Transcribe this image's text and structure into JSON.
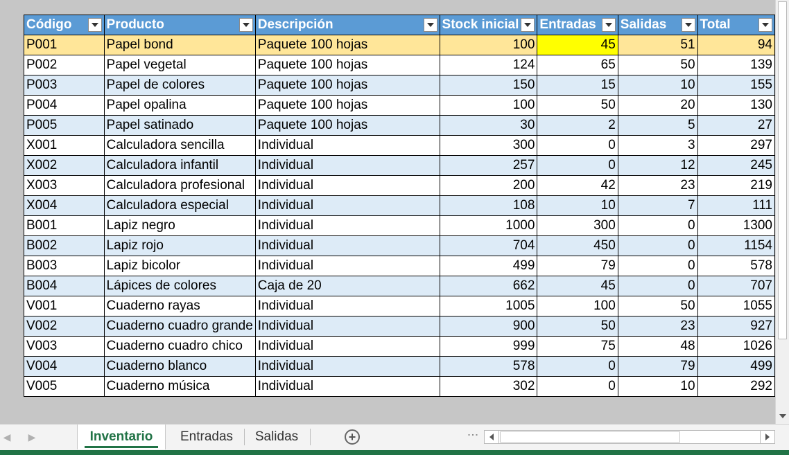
{
  "table": {
    "headers": [
      "Código",
      "Producto",
      "Descripción",
      "Stock inicial",
      "Entradas",
      "Salidas",
      "Total"
    ],
    "rows": [
      [
        "P001",
        "Papel bond",
        "Paquete 100 hojas",
        "100",
        "45",
        "51",
        "94"
      ],
      [
        "P002",
        "Papel vegetal",
        "Paquete 100 hojas",
        "124",
        "65",
        "50",
        "139"
      ],
      [
        "P003",
        "Papel de colores",
        "Paquete 100 hojas",
        "150",
        "15",
        "10",
        "155"
      ],
      [
        "P004",
        "Papel opalina",
        "Paquete 100 hojas",
        "100",
        "50",
        "20",
        "130"
      ],
      [
        "P005",
        "Papel satinado",
        "Paquete 100 hojas",
        "30",
        "2",
        "5",
        "27"
      ],
      [
        "X001",
        "Calculadora sencilla",
        "Individual",
        "300",
        "0",
        "3",
        "297"
      ],
      [
        "X002",
        "Calculadora infantil",
        "Individual",
        "257",
        "0",
        "12",
        "245"
      ],
      [
        "X003",
        "Calculadora profesional",
        "Individual",
        "200",
        "42",
        "23",
        "219"
      ],
      [
        "X004",
        "Calculadora especial",
        "Individual",
        "108",
        "10",
        "7",
        "111"
      ],
      [
        "B001",
        "Lapiz negro",
        "Individual",
        "1000",
        "300",
        "0",
        "1300"
      ],
      [
        "B002",
        "Lapiz rojo",
        "Individual",
        "704",
        "450",
        "0",
        "1154"
      ],
      [
        "B003",
        "Lapiz bicolor",
        "Individual",
        "499",
        "79",
        "0",
        "578"
      ],
      [
        "B004",
        "Lápices de colores",
        "Caja de 20",
        "662",
        "45",
        "0",
        "707"
      ],
      [
        "V001",
        "Cuaderno rayas",
        "Individual",
        "1005",
        "100",
        "50",
        "1055"
      ],
      [
        "V002",
        "Cuaderno cuadro grande",
        "Individual",
        "900",
        "50",
        "23",
        "927"
      ],
      [
        "V003",
        "Cuaderno cuadro chico",
        "Individual",
        "999",
        "75",
        "48",
        "1026"
      ],
      [
        "V004",
        "Cuaderno blanco",
        "Individual",
        "578",
        "0",
        "79",
        "499"
      ],
      [
        "V005",
        "Cuaderno música",
        "Individual",
        "302",
        "0",
        "10",
        "292"
      ]
    ],
    "numeric_columns": [
      3,
      4,
      5,
      6
    ],
    "selected_row": 0,
    "highlighted_cell": {
      "row": 0,
      "col": 4
    }
  },
  "colors": {
    "header_bg": "#5b9bd5",
    "band_bg": "#ddebf7",
    "selected_row_bg": "#ffe699",
    "highlight_cell_bg": "#ffff00",
    "accent": "#217346"
  },
  "sheet_tabs": [
    {
      "label": "Inventario",
      "active": true
    },
    {
      "label": "Entradas",
      "active": false
    },
    {
      "label": "Salidas",
      "active": false
    }
  ],
  "icons": {
    "filter": "dropdown-arrow-icon",
    "add_sheet": "plus-circle-icon",
    "add_sheet_glyph": "+",
    "nav_prev": "chevron-left-icon",
    "nav_prev_glyph": "◀",
    "nav_next": "chevron-right-icon",
    "nav_next_glyph": "▶",
    "options": "vertical-dots-icon",
    "options_glyph": "⋮"
  }
}
